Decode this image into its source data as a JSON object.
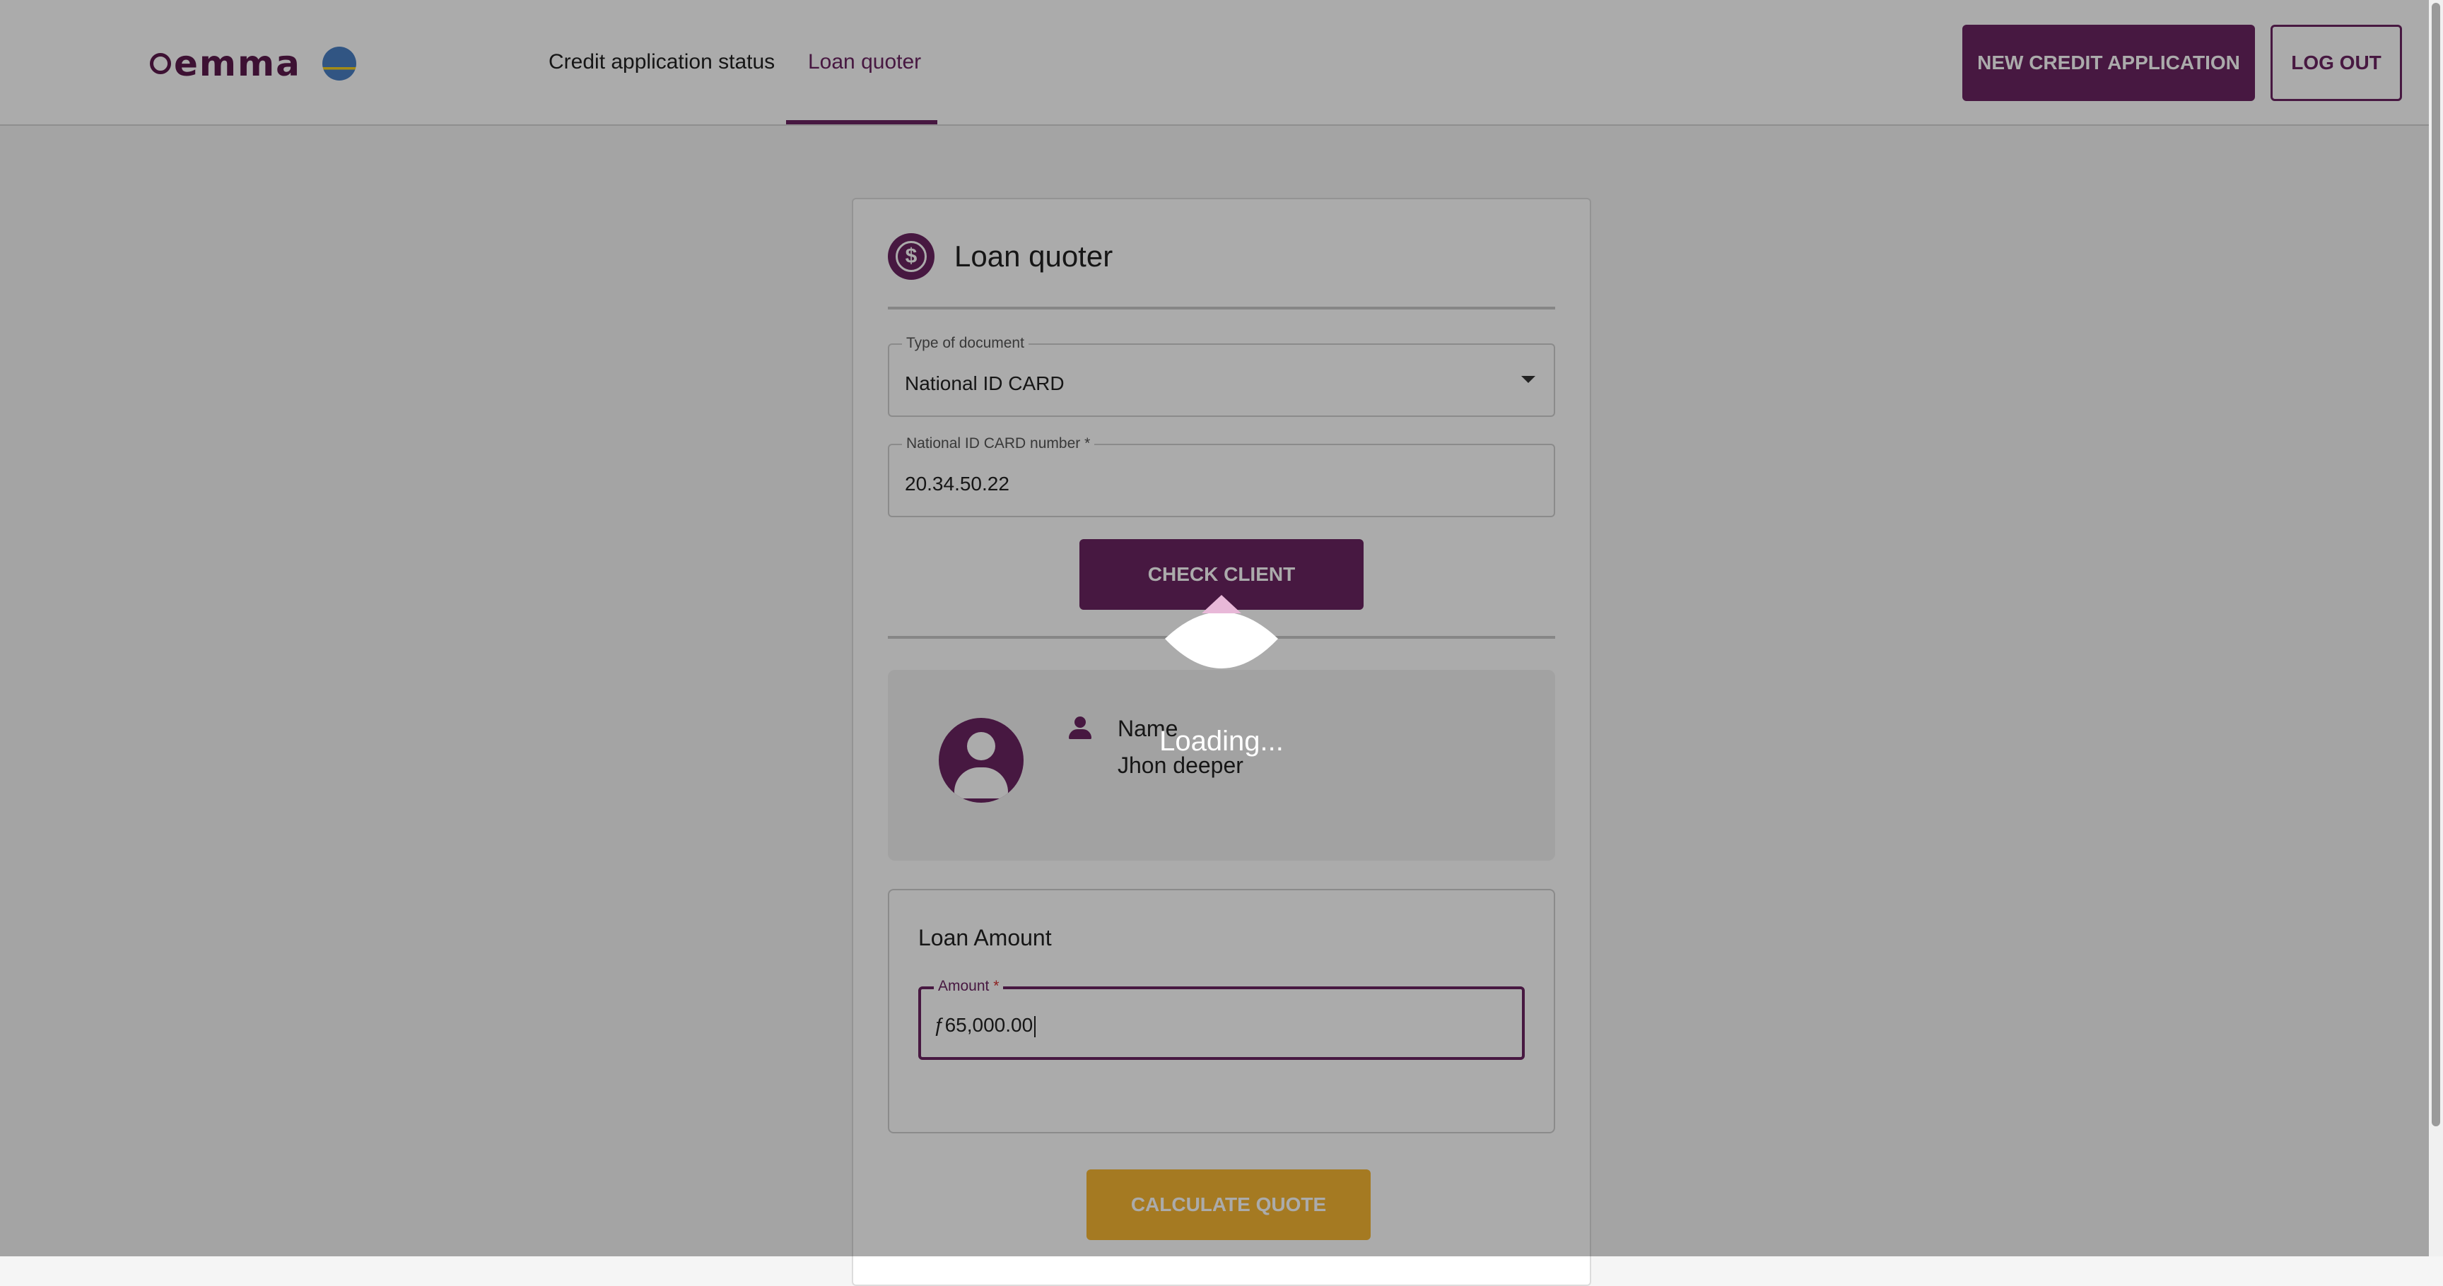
{
  "header": {
    "logo_text": "emma",
    "flag_icon": "aruba-flag-icon",
    "nav": {
      "status": "Credit application status",
      "quoter": "Loan quoter"
    },
    "new_application_label": "NEW CREDIT APPLICATION",
    "logout_label": "LOG OUT"
  },
  "card": {
    "icon": "dollar-icon",
    "title": "Loan quoter",
    "document_type": {
      "label": "Type of document",
      "value": "National ID CARD"
    },
    "id_number": {
      "label": "National ID CARD number *",
      "value": "20.34.50.22"
    },
    "check_client_label": "CHECK CLIENT",
    "client": {
      "name_label": "Name",
      "name_value": "Jhon deeper"
    },
    "loan": {
      "title": "Loan Amount",
      "amount_label": "Amount",
      "amount_required": "*",
      "amount_value": "ƒ65,000.00"
    },
    "calculate_label": "CALCULATE QUOTE"
  },
  "overlay": {
    "loading_text": "Loading..."
  },
  "colors": {
    "brand": "#6b2461",
    "accent": "#f7b733"
  }
}
